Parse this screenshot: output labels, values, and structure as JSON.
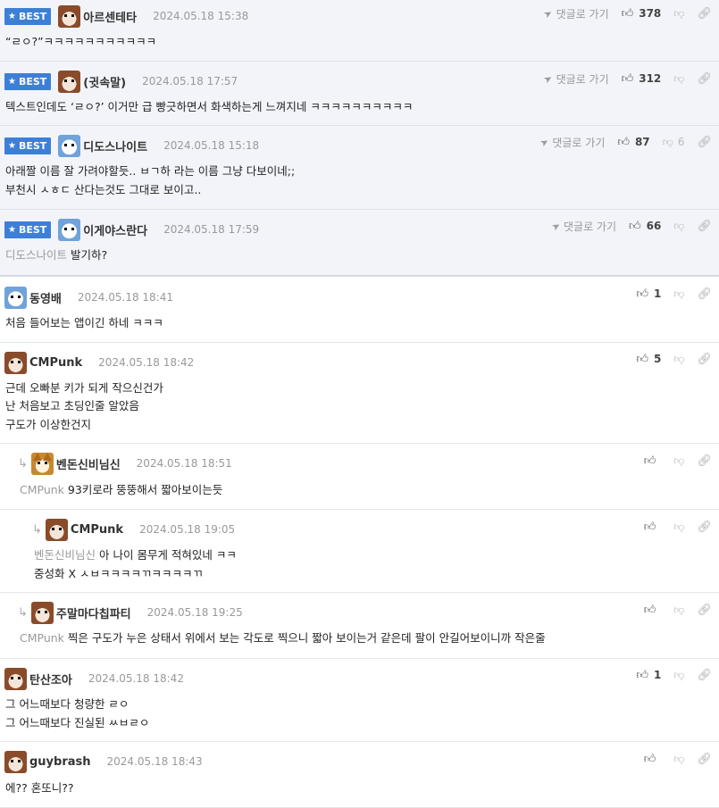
{
  "labels": {
    "best": "BEST",
    "goto_parent": "댓글로 가기"
  },
  "comments": [
    {
      "nick": "아르센테타",
      "date": "2024.05.18 15:38",
      "text": "“ㄹㅇ?”ㅋㅋㅋㅋㅋㅋㅋㅋㅋㅋㅋ",
      "up": "378",
      "down": ""
    },
    {
      "nick": "(귓속말)",
      "date": "2024.05.18 17:57",
      "text": "텍스트인데도 ‘ㄹㅇ?’ 이거만 급 빵긋하면서 화색하는게 느껴지네 ㅋㅋㅋㅋㅋㅋㅋㅋㅋㅋ",
      "up": "312",
      "down": ""
    },
    {
      "nick": "디도스나이트",
      "date": "2024.05.18 15:18",
      "line1": "아래짤 이름 잘 가려야할듯.. ㅂㄱ하 라는 이름 그냥 다보이네;;",
      "line2": "부천시 ㅅㅎㄷ 산다는것도 그대로 보이고..",
      "up": "87",
      "down": "6"
    },
    {
      "nick": "이게야스란다",
      "date": "2024.05.18 17:59",
      "mention": "디도스나이트",
      "text": "발기하?",
      "up": "66",
      "down": ""
    },
    {
      "nick": "동영배",
      "date": "2024.05.18 18:41",
      "text": "처음 들어보는 앱이긴 하네 ㅋㅋㅋ",
      "up": "1",
      "down": ""
    },
    {
      "nick": "CMPunk",
      "date": "2024.05.18 18:42",
      "line1": "근데 오빠분 키가 되게 작으신건가",
      "line2": "난 처음보고 초딩인줄 알았음",
      "line3": "구도가 이상한건지",
      "up": "5",
      "down": ""
    },
    {
      "nick": "벤돈신비님신",
      "date": "2024.05.18 18:51",
      "mention": "CMPunk",
      "text": "93키로라 뚱뚱해서 짧아보이는듯",
      "up": "",
      "down": ""
    },
    {
      "nick": "CMPunk",
      "date": "2024.05.18 19:05",
      "mention": "벤돈신비님신",
      "text": "아 나이 몸무게 적혀있네 ㅋㅋ",
      "line2": "중성화 X ㅅㅂㅋㅋㅋㅋㄲㅋㅋㅋㅋㄲ",
      "up": "",
      "down": ""
    },
    {
      "nick": "주말마다칩파티",
      "date": "2024.05.18 19:25",
      "mention": "CMPunk",
      "text": "찍은 구도가 누은 상태서 위에서 보는 각도로 찍으니 짧아 보이는거 같은데 팔이 안길어보이니까 작은줄",
      "up": "",
      "down": ""
    },
    {
      "nick": "탄산조아",
      "date": "2024.05.18 18:42",
      "line1": "그 어느때보다 청량한 ㄹㅇ",
      "line2": "그 어느때보다 진실된 ㅆㅂㄹㅇ",
      "up": "1",
      "down": ""
    },
    {
      "nick": "guybrash",
      "date": "2024.05.18 18:43",
      "text": "에?? 혼또니??",
      "up": "",
      "down": ""
    }
  ]
}
